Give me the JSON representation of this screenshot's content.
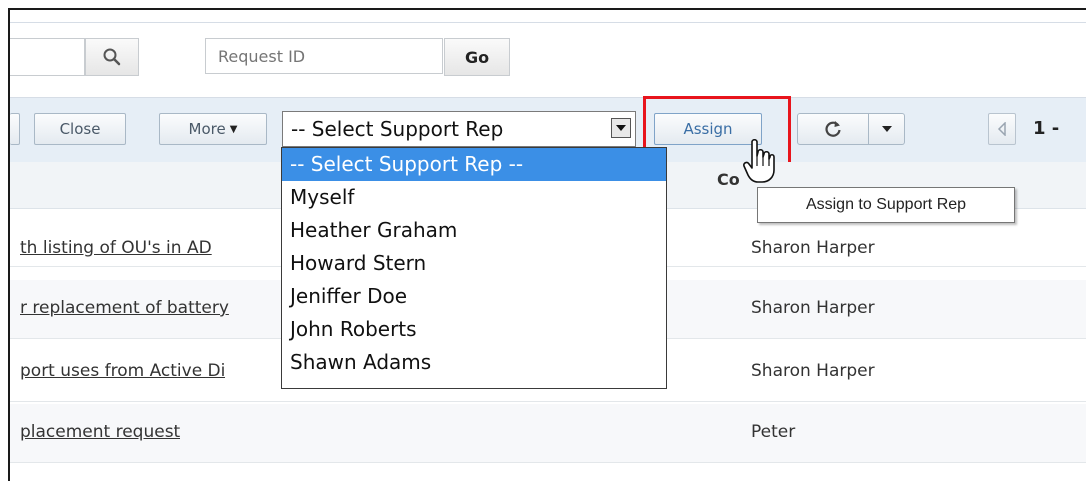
{
  "search": {
    "value": "",
    "request_id_placeholder": "Request ID",
    "go_label": "Go"
  },
  "toolbar": {
    "close_label": "Close",
    "more_label": "More",
    "select_support_rep": "-- Select Support Rep",
    "assign_label": "Assign",
    "page_indicator": "1 -"
  },
  "dropdown": {
    "options": [
      "-- Select Support Rep --",
      "Myself",
      "Heather Graham",
      "Howard Stern",
      "Jeniffer Doe",
      "John Roberts",
      "Shawn Adams"
    ],
    "selected_index": 0
  },
  "table": {
    "partial_column_header": "Co",
    "rows": [
      {
        "title": "th listing of OU's in AD",
        "contact": "Sharon Harper"
      },
      {
        "title": "r replacement of battery",
        "contact": "Sharon Harper"
      },
      {
        "title": "port uses from Active Di",
        "contact": "Sharon Harper"
      },
      {
        "title": "placement request",
        "contact": "Peter"
      }
    ]
  },
  "tooltip": {
    "text": "Assign to Support Rep"
  },
  "colors": {
    "highlight_box": "#e8141c",
    "selected_option": "#3b8fe6",
    "toolbar_bg": "#e6eef6"
  }
}
